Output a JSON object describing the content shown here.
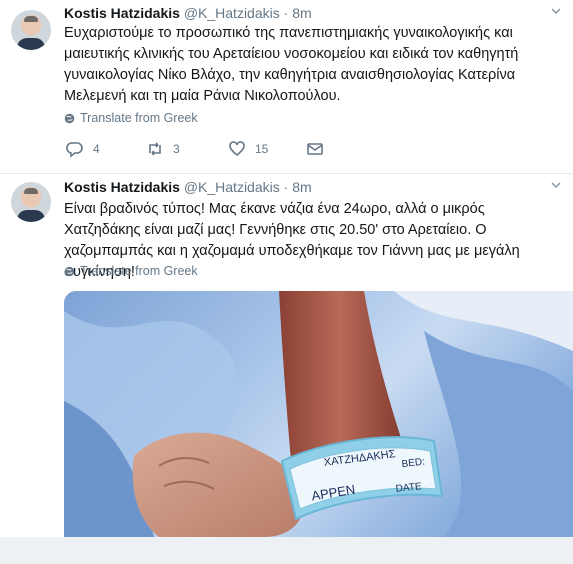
{
  "tweets": [
    {
      "name": "Kostis Hatzidakis",
      "handle": "@K_Hatzidakis",
      "separator": "·",
      "time": "8m",
      "text": "Ευχαριστούμε το προσωπικό της πανεπιστημιακής γυναικολογικής και μαιευτικής κλινικής του Αρεταίειου νοσοκομείου και ειδικά τον καθηγητή γυναικολογίας Νίκο Βλάχο, την καθηγήτρια αναισθησιολογίας Κατερίνα Μελεμενή και τη μαία Ράνια Νικολοπούλου.",
      "translate": "Translate from Greek",
      "actions": {
        "replies": "4",
        "retweets": "3",
        "likes": "15"
      }
    },
    {
      "name": "Kostis Hatzidakis",
      "handle": "@K_Hatzidakis",
      "separator": "·",
      "time": "8m",
      "text": "Είναι βραδινός τύπος! Μας έκανε νάζια ένα 24ωρο, αλλά ο μικρός Χατζηδάκης είναι μαζί μας! Γεννήθηκε στις 20.50' στο Αρεταίειο. Ο χαζομπαμπάς και η χαζομαμά υποδεχθήκαμε τον Γιάννη μας με μεγάλη συγκίνηση!",
      "translate": "Translate from Greek",
      "photo_band": {
        "line1": "ΧΑΤΖΗΔΑΚΗΣ",
        "bed": "BED:",
        "name": "APPEN",
        "date": "DATE"
      }
    }
  ],
  "icons": [
    "reply-icon",
    "retweet-icon",
    "like-icon",
    "direct-message-icon",
    "globe-icon",
    "chevron-down-icon"
  ],
  "colors": {
    "text": "#14171a",
    "secondary": "#657786",
    "border": "#e6ecf0",
    "band": "#8fd0e8"
  }
}
